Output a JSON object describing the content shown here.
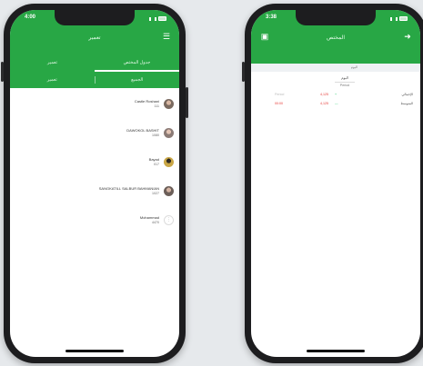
{
  "colors": {
    "accent": "#28a745",
    "red": "#e53935",
    "green": "#2ecc71"
  },
  "left_phone": {
    "status_time": "4:00",
    "appbar_title": "تعمیر",
    "menu_icon": "hamburger-icon",
    "tabs_top": [
      {
        "label": "تعمیر",
        "active": false
      },
      {
        "label": "جدول المختص",
        "active": true
      }
    ],
    "tabs_sub": [
      {
        "label": "تعمیر"
      },
      {
        "label": "الجميع"
      }
    ],
    "contacts": [
      {
        "name": "Castle Roshani",
        "sub": "111",
        "avatar": "av-a"
      },
      {
        "name": "DAWOKOL BASHIT",
        "sub": "1080",
        "avatar": "av-b"
      },
      {
        "name": "Bayad",
        "sub": "017",
        "avatar": "av-c"
      },
      {
        "name": "SANGKATILL SALBUR BAHMANIAN",
        "sub": "1027",
        "avatar": "av-d"
      },
      {
        "name": "Mohammad",
        "sub": "4470",
        "avatar": "av-e"
      }
    ]
  },
  "right_phone": {
    "status_time": "3:38",
    "appbar_title": "المختص",
    "back_icon": "arrow-right-icon",
    "settings_icon": "calendar-icon",
    "filter_label": "اليوم",
    "summary": {
      "line1": "اليوم",
      "line2": "Period"
    },
    "rows": [
      {
        "label": "الإجمالي",
        "value_red": "4,125",
        "value_green": "+",
        "value_high": "Period"
      },
      {
        "label": "المتوسط",
        "value_red": "4,125",
        "value_green": "—",
        "value_high": "00:00"
      }
    ]
  }
}
